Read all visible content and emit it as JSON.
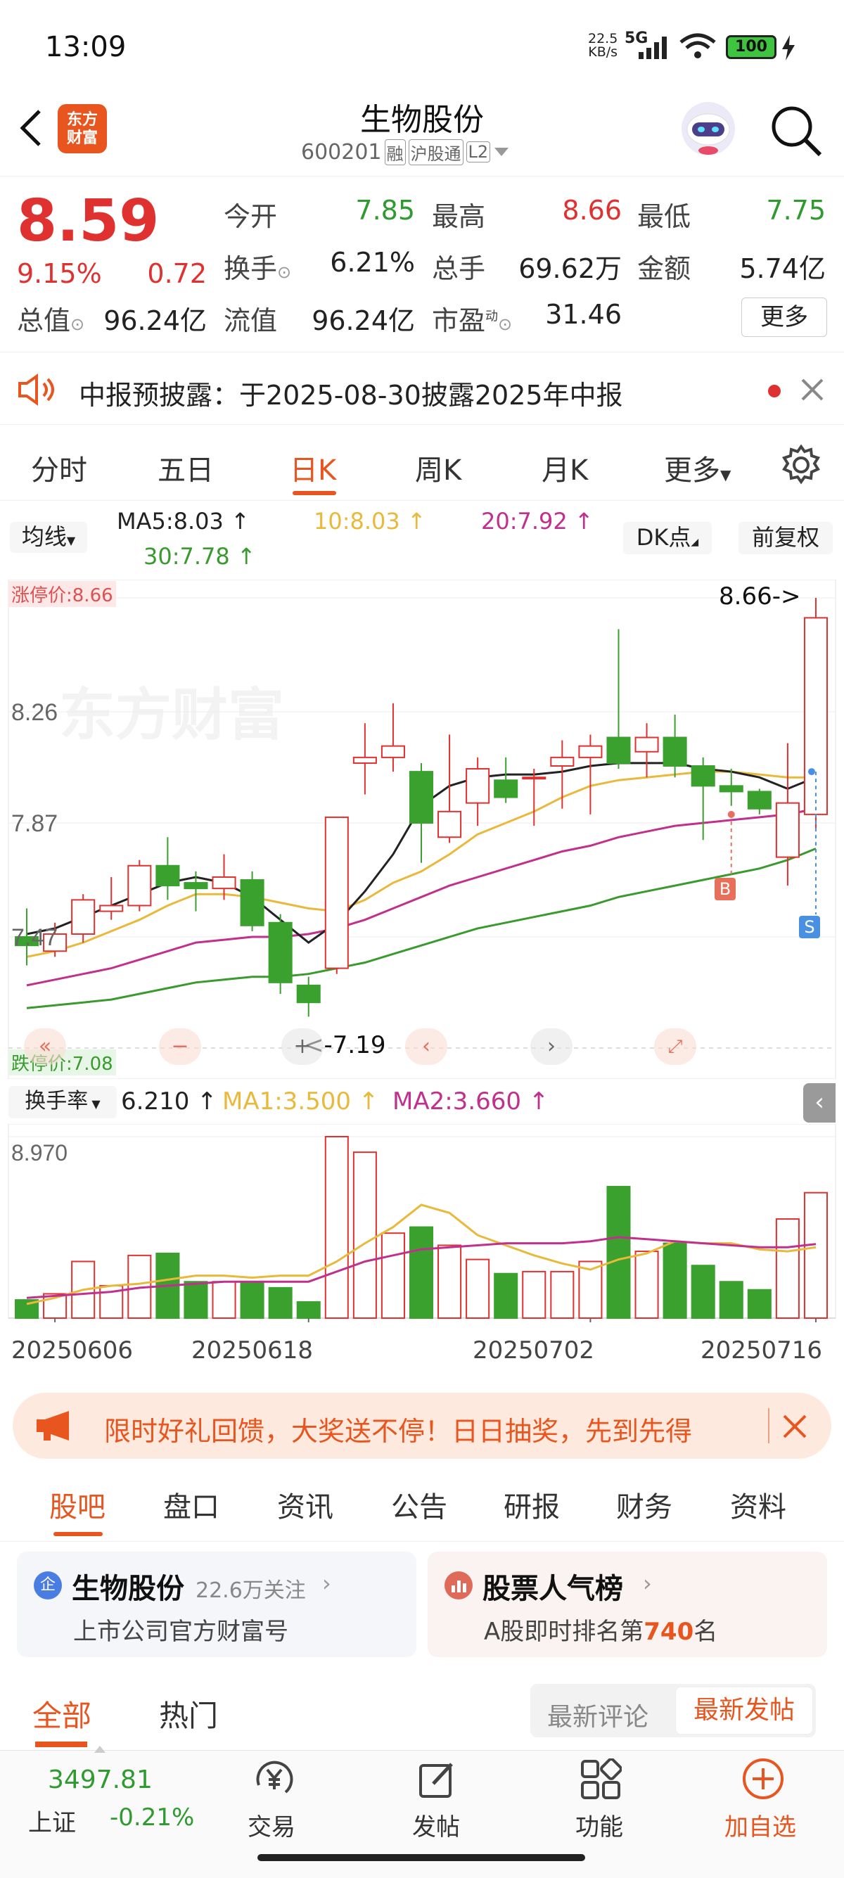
{
  "status_bar": {
    "time": "13:09",
    "speed_value": "22.5",
    "speed_unit": "KB/s",
    "network": "5G",
    "battery": "100"
  },
  "header": {
    "logo_line1": "东方",
    "logo_line2": "财富",
    "stock_name": "生物股份",
    "stock_code": "600201",
    "badge_margin": "融",
    "badge_connect": "沪股通",
    "badge_level": "L2"
  },
  "quote": {
    "price": "8.59",
    "change_pct": "9.15%",
    "change_amt": "0.72",
    "open_label": "今开",
    "open": "7.85",
    "high_label": "最高",
    "high": "8.66",
    "low_label": "最低",
    "low": "7.75",
    "turnover_label": "换手",
    "turnover": "6.21%",
    "volume_label": "总手",
    "volume": "69.62万",
    "amount_label": "金额",
    "amount": "5.74亿",
    "mktcap_label": "总值",
    "mktcap": "96.24亿",
    "float_label": "流值",
    "float": "96.24亿",
    "pe_label": "市盈",
    "pe_sup": "动",
    "pe": "31.46",
    "more_label": "更多"
  },
  "notice": {
    "text": "中报预披露：于2025-08-30披露2025年中报"
  },
  "chart_tabs": [
    "分时",
    "五日",
    "日K",
    "周K",
    "月K",
    "更多"
  ],
  "kline_toolbar": {
    "ma_select": "均线",
    "ma5": "MA5:8.03",
    "ma10": "10:8.03",
    "ma20": "20:7.92",
    "ma30": "30:7.78",
    "dk_button": "DK点",
    "adjust_button": "前复权"
  },
  "kline": {
    "limit_up_label": "涨停价:8.66",
    "limit_down_label": "跌停价:7.08",
    "high_marker": "8.66->",
    "low_marker": "<-7.19",
    "marker_b": "B",
    "marker_s": "S"
  },
  "volume_toolbar": {
    "select": "换手率",
    "value": "6.210",
    "ma1": "MA1:3.500",
    "ma2": "MA2:3.660"
  },
  "colors": {
    "up": "#e03131",
    "down": "#3ba12e",
    "ma5": "#222222",
    "ma10": "#e8b93a",
    "ma20": "#c0308c",
    "ma30": "#3a9a2e",
    "accent": "#e8551e"
  },
  "chart_data": {
    "type": "candlestick",
    "price_axis_ticks": [
      "8.66",
      "8.26",
      "7.87",
      "7.47"
    ],
    "turnover_axis_ticks": [
      "8.970"
    ],
    "x_tick_labels": [
      "20250606",
      "20250618",
      "20250702",
      "20250716"
    ],
    "ylim": [
      7.08,
      8.66
    ],
    "candles": [
      {
        "o": 7.47,
        "c": 7.44,
        "h": 7.57,
        "l": 7.37
      },
      {
        "o": 7.42,
        "c": 7.48,
        "h": 7.52,
        "l": 7.4
      },
      {
        "o": 7.48,
        "c": 7.6,
        "h": 7.62,
        "l": 7.45
      },
      {
        "o": 7.56,
        "c": 7.58,
        "h": 7.68,
        "l": 7.53
      },
      {
        "o": 7.58,
        "c": 7.72,
        "h": 7.74,
        "l": 7.56
      },
      {
        "o": 7.72,
        "c": 7.65,
        "h": 7.82,
        "l": 7.6
      },
      {
        "o": 7.66,
        "c": 7.64,
        "h": 7.7,
        "l": 7.56
      },
      {
        "o": 7.64,
        "c": 7.68,
        "h": 7.76,
        "l": 7.6
      },
      {
        "o": 7.67,
        "c": 7.51,
        "h": 7.7,
        "l": 7.49
      },
      {
        "o": 7.52,
        "c": 7.31,
        "h": 7.55,
        "l": 7.27
      },
      {
        "o": 7.3,
        "c": 7.24,
        "h": 7.33,
        "l": 7.19
      },
      {
        "o": 7.36,
        "c": 7.89,
        "h": 7.89,
        "l": 7.34
      },
      {
        "o": 8.08,
        "c": 8.1,
        "h": 8.22,
        "l": 7.97
      },
      {
        "o": 8.1,
        "c": 8.14,
        "h": 8.29,
        "l": 8.05
      },
      {
        "o": 8.05,
        "c": 7.87,
        "h": 8.08,
        "l": 7.73
      },
      {
        "o": 7.82,
        "c": 7.91,
        "h": 8.18,
        "l": 7.8
      },
      {
        "o": 7.94,
        "c": 8.06,
        "h": 8.1,
        "l": 7.86
      },
      {
        "o": 8.02,
        "c": 7.96,
        "h": 8.1,
        "l": 7.94
      },
      {
        "o": 8.03,
        "c": 8.03,
        "h": 8.06,
        "l": 7.86
      },
      {
        "o": 8.07,
        "c": 8.1,
        "h": 8.16,
        "l": 7.92
      },
      {
        "o": 8.1,
        "c": 8.14,
        "h": 8.18,
        "l": 7.9
      },
      {
        "o": 8.17,
        "c": 8.08,
        "h": 8.55,
        "l": 8.06
      },
      {
        "o": 8.12,
        "c": 8.17,
        "h": 8.22,
        "l": 8.03
      },
      {
        "o": 8.17,
        "c": 8.07,
        "h": 8.25,
        "l": 8.03
      },
      {
        "o": 8.07,
        "c": 8.0,
        "h": 8.1,
        "l": 7.81
      },
      {
        "o": 8.0,
        "c": 7.98,
        "h": 8.06,
        "l": 7.93
      },
      {
        "o": 7.98,
        "c": 7.92,
        "h": 7.99,
        "l": 7.9
      },
      {
        "o": 7.75,
        "c": 7.94,
        "h": 8.15,
        "l": 7.65
      },
      {
        "o": 7.9,
        "c": 8.59,
        "h": 8.66,
        "l": 7.85
      }
    ],
    "ma5": [
      7.48,
      7.5,
      7.54,
      7.58,
      7.62,
      7.66,
      7.68,
      7.66,
      7.61,
      7.53,
      7.45,
      7.52,
      7.63,
      7.76,
      7.93,
      8.0,
      8.03,
      8.04,
      8.04,
      8.05,
      8.07,
      8.08,
      8.08,
      8.08,
      8.06,
      8.05,
      8.03,
      7.99,
      8.03
    ],
    "ma10": [
      7.4,
      7.42,
      7.45,
      7.49,
      7.53,
      7.58,
      7.62,
      7.62,
      7.61,
      7.59,
      7.57,
      7.56,
      7.6,
      7.66,
      7.7,
      7.76,
      7.83,
      7.87,
      7.91,
      7.96,
      8.0,
      8.02,
      8.03,
      8.04,
      8.05,
      8.05,
      8.04,
      8.03,
      8.03
    ],
    "ma20": [
      7.3,
      7.32,
      7.34,
      7.36,
      7.39,
      7.42,
      7.45,
      7.46,
      7.47,
      7.47,
      7.48,
      7.5,
      7.53,
      7.57,
      7.61,
      7.65,
      7.68,
      7.71,
      7.74,
      7.77,
      7.79,
      7.82,
      7.84,
      7.86,
      7.87,
      7.88,
      7.89,
      7.9,
      7.92
    ],
    "ma30": [
      7.22,
      7.23,
      7.24,
      7.25,
      7.27,
      7.29,
      7.31,
      7.32,
      7.33,
      7.33,
      7.34,
      7.36,
      7.38,
      7.41,
      7.44,
      7.47,
      7.5,
      7.52,
      7.54,
      7.56,
      7.58,
      7.61,
      7.63,
      7.65,
      7.67,
      7.69,
      7.71,
      7.74,
      7.78
    ],
    "turnover_max": 8.97,
    "turnover": [
      0.9,
      1.2,
      2.8,
      1.6,
      3.1,
      3.2,
      1.8,
      1.8,
      1.8,
      1.5,
      0.8,
      8.97,
      8.2,
      4.2,
      4.5,
      3.6,
      2.9,
      2.2,
      2.3,
      2.3,
      2.8,
      6.5,
      3.3,
      3.7,
      2.6,
      1.8,
      1.4,
      4.9,
      6.2
    ],
    "turnover_ma1": [
      0.7,
      1.0,
      1.4,
      1.6,
      1.7,
      1.9,
      2.1,
      2.1,
      2.0,
      2.1,
      2.1,
      2.8,
      3.7,
      4.5,
      5.6,
      5.2,
      4.1,
      3.6,
      3.1,
      2.7,
      2.4,
      2.9,
      3.2,
      3.8,
      3.7,
      3.7,
      3.4,
      3.3,
      3.5
    ],
    "turnover_ma2": [
      1.0,
      1.1,
      1.2,
      1.3,
      1.5,
      1.6,
      1.7,
      1.8,
      1.8,
      1.8,
      1.8,
      2.3,
      2.8,
      3.1,
      3.4,
      3.5,
      3.6,
      3.7,
      3.7,
      3.7,
      3.8,
      4.0,
      3.9,
      3.8,
      3.7,
      3.6,
      3.5,
      3.5,
      3.66
    ]
  },
  "banner": {
    "text": "限时好礼回馈，大奖送不停！日日抽奖，先到先得"
  },
  "bottom_tabs": [
    "股吧",
    "盘口",
    "资讯",
    "公告",
    "研报",
    "财务",
    "资料"
  ],
  "cards": {
    "official": {
      "icon": "企",
      "title": "生物股份",
      "followers": "22.6万关注",
      "subtitle": "上市公司官方财富号"
    },
    "popularity": {
      "title": "股票人气榜",
      "subtitle_pre": "A股即时排名第",
      "rank": "740",
      "subtitle_post": "名"
    }
  },
  "feed": {
    "tab_all": "全部",
    "tab_hot": "热门",
    "sort_latest_comment": "最新评论",
    "sort_latest_post": "最新发帖"
  },
  "navbar": {
    "index_value": "3497.81",
    "index_name": "上证",
    "index_change": "-0.21%",
    "trade": "交易",
    "post": "发帖",
    "functions": "功能",
    "add_watch": "加自选"
  }
}
